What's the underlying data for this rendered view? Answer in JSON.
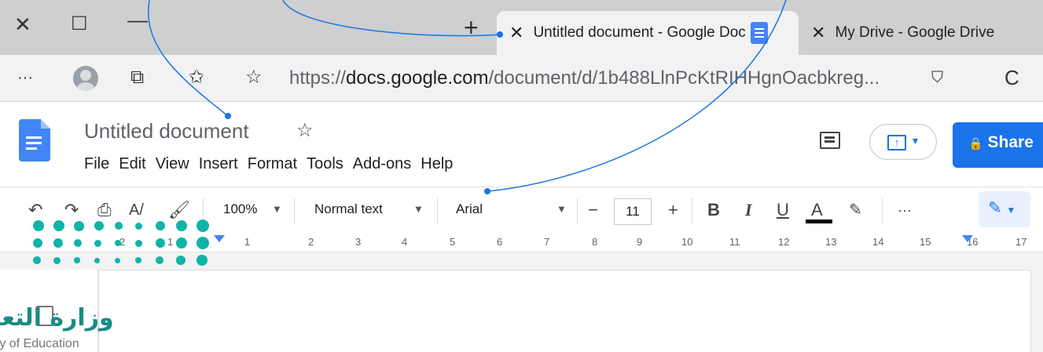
{
  "window": {
    "close_glyph": "✕",
    "maximize_glyph": "☐",
    "minimize_glyph": "—",
    "new_tab_glyph": "+"
  },
  "tabs": [
    {
      "label": "Untitled document - Google Doc",
      "close": "✕",
      "active": true
    },
    {
      "label": "My Drive - Google Drive",
      "close": "✕",
      "active": false
    }
  ],
  "addressbar": {
    "more": "···",
    "url_prefix": "https://",
    "url_domain": "docs.google.com",
    "url_path": "/document/d/1b488LlnPcKtRIHHgnOacbkreg...",
    "refresh": "C"
  },
  "docs": {
    "title": "Untitled document",
    "star": "☆",
    "menu": [
      "File",
      "Edit",
      "View",
      "Insert",
      "Format",
      "Tools",
      "Add-ons",
      "Help"
    ],
    "share_label": "Share",
    "lock_glyph": "🔒"
  },
  "toolbar": {
    "zoom": "100%",
    "style": "Normal text",
    "font": "Arial",
    "minus": "−",
    "font_size": "11",
    "plus": "+",
    "bold": "B",
    "italic": "I",
    "underline": "U",
    "text_color": "A",
    "more": "···",
    "text_color_value": "#000000"
  },
  "ruler": {
    "labels": [
      "2",
      "1",
      "",
      "1",
      "2",
      "3",
      "4",
      "5",
      "6",
      "7",
      "8",
      "9",
      "10",
      "11",
      "12",
      "13",
      "14",
      "15",
      "16",
      "17"
    ]
  },
  "watermark": {
    "arabic": "وزارة التعـ",
    "english": "ry of Education"
  },
  "colors": {
    "accent": "#1a73e8",
    "docs_blue": "#4285f4",
    "watermark_teal": "#10b3a8"
  }
}
